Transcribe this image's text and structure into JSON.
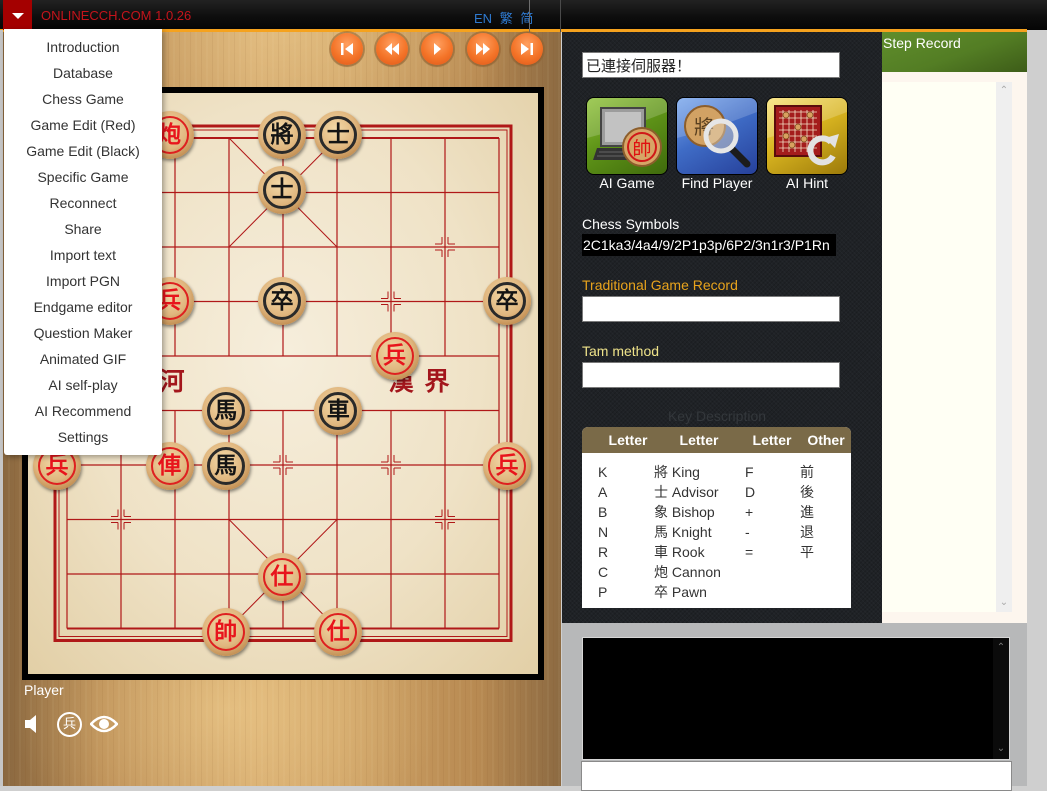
{
  "topbar": {
    "menu_toggle_icon": "caret-down-icon",
    "title": "ONLINECCH.COM 1.0.26",
    "languages": [
      "EN",
      "繁",
      "简"
    ]
  },
  "menu": {
    "items": [
      "Introduction",
      "Database",
      "Chess Game",
      "Game Edit (Red)",
      "Game Edit (Black)",
      "Specific Game",
      "Reconnect",
      "Share",
      "Import text",
      "Import PGN",
      "Endgame editor",
      "Question Maker",
      "Animated GIF",
      "AI self-play",
      "AI Recommend",
      "Settings"
    ]
  },
  "playback": [
    {
      "action": "first",
      "icon": "skip-to-start-icon"
    },
    {
      "action": "previous",
      "icon": "rewind-icon"
    },
    {
      "action": "play",
      "icon": "play-icon"
    },
    {
      "action": "next",
      "icon": "fast-forward-icon"
    },
    {
      "action": "last",
      "icon": "skip-to-end-icon"
    }
  ],
  "board": {
    "river_text": [
      "河",
      "漢",
      "界"
    ],
    "pieces": [
      {
        "char": "炮",
        "side": "red",
        "type": "cannon",
        "file": 2,
        "rank": 0
      },
      {
        "char": "將",
        "side": "black",
        "type": "king",
        "file": 4,
        "rank": 0
      },
      {
        "char": "士",
        "side": "black",
        "type": "advisor",
        "file": 5,
        "rank": 0
      },
      {
        "char": "士",
        "side": "black",
        "type": "advisor",
        "file": 4,
        "rank": 1
      },
      {
        "char": "兵",
        "side": "red",
        "type": "pawn",
        "file": 2,
        "rank": 3
      },
      {
        "char": "卒",
        "side": "black",
        "type": "pawn",
        "file": 4,
        "rank": 3
      },
      {
        "char": "卒",
        "side": "black",
        "type": "pawn",
        "file": 8,
        "rank": 3
      },
      {
        "char": "兵",
        "side": "red",
        "type": "pawn",
        "file": 6,
        "rank": 4
      },
      {
        "char": "馬",
        "side": "black",
        "type": "knight",
        "file": 3,
        "rank": 5
      },
      {
        "char": "車",
        "side": "black",
        "type": "rook",
        "file": 5,
        "rank": 5
      },
      {
        "char": "兵",
        "side": "red",
        "type": "pawn",
        "file": 0,
        "rank": 6
      },
      {
        "char": "俥",
        "side": "red",
        "type": "rook",
        "file": 2,
        "rank": 6
      },
      {
        "char": "馬",
        "side": "black",
        "type": "knight",
        "file": 3,
        "rank": 6
      },
      {
        "char": "兵",
        "side": "red",
        "type": "pawn",
        "file": 8,
        "rank": 6
      },
      {
        "char": "仕",
        "side": "red",
        "type": "advisor",
        "file": 4,
        "rank": 8
      },
      {
        "char": "帥",
        "side": "red",
        "type": "king",
        "file": 3,
        "rank": 9
      },
      {
        "char": "仕",
        "side": "red",
        "type": "advisor",
        "file": 5,
        "rank": 9
      }
    ]
  },
  "player": {
    "label": "Player",
    "controls": [
      {
        "icon": "speaker-icon",
        "glyph": ""
      },
      {
        "icon": "pawn-badge-icon",
        "glyph": "兵"
      },
      {
        "icon": "eye-icon",
        "glyph": ""
      }
    ]
  },
  "status": {
    "message": "已連接伺服器！"
  },
  "tools": [
    {
      "label": "AI Game",
      "glyph": "帥"
    },
    {
      "label": "Find Player",
      "glyph": "將"
    },
    {
      "label": "AI Hint",
      "glyph": ""
    }
  ],
  "chess_symbols": {
    "label": "Chess Symbols",
    "value": "2C1ka3/4a4/9/2P1p3p/6P2/3n1r3/P1Rn"
  },
  "traditional_record": {
    "label": "Traditional Game Record",
    "value": ""
  },
  "tam_method": {
    "label": "Tam method",
    "value": ""
  },
  "key_description": {
    "title": "Key Description",
    "headers": [
      "Letter",
      "Letter",
      "Letter",
      "Other"
    ],
    "rows": [
      [
        "K",
        "將 King",
        "F",
        "前"
      ],
      [
        "A",
        "士 Advisor",
        "D",
        "後"
      ],
      [
        "B",
        "象 Bishop",
        "+",
        "進"
      ],
      [
        "N",
        "馬 Knight",
        "-",
        "退"
      ],
      [
        "R",
        "車 Rook",
        "=",
        "平"
      ],
      [
        "C",
        "炮 Cannon",
        "",
        ""
      ],
      [
        "P",
        "卒 Pawn",
        "",
        ""
      ]
    ]
  },
  "step_record": {
    "title": "Step Record",
    "moves": []
  },
  "chat": {
    "log": "",
    "input": ""
  },
  "colors": {
    "brand_red": "#c4141b",
    "accent_orange": "#f5a21e",
    "language_blue": "#2f7ad0",
    "red_piece": "#e8141c",
    "black_piece": "#141414",
    "board_line": "#b01818",
    "step_header_green": "#537d24",
    "key_header_brown": "#7a6a48",
    "traditional_label": "#e8a31c",
    "tam_label": "#efe38a"
  }
}
